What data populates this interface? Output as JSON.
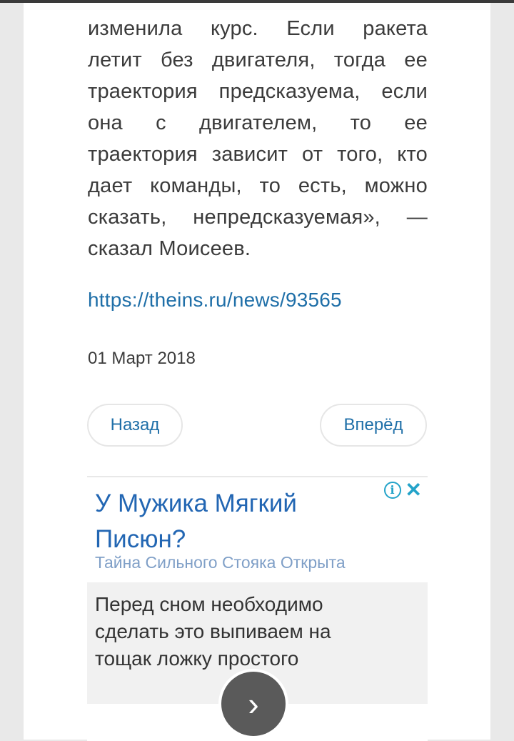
{
  "article": {
    "lines": [
      [
        "изменила",
        "курс.",
        "Если",
        "ракета"
      ],
      [
        "летит",
        "без",
        "двигателя,",
        "тогда",
        "ее"
      ],
      [
        "траектория",
        "предсказуема,",
        "если"
      ],
      [
        "она",
        "с",
        "двигателем,",
        "то",
        "ее"
      ],
      [
        "траектория",
        "зависит",
        "от",
        "того,",
        "кто"
      ],
      [
        "дает",
        "команды,",
        "то",
        "есть,",
        "можно"
      ],
      [
        "сказать,",
        "непредсказуемая»,",
        "—"
      ],
      [
        "сказал",
        "Моисеев."
      ]
    ]
  },
  "source_link": "https://theins.ru/news/93565",
  "date": "01 Март 2018",
  "nav": {
    "back_label": "Назад",
    "forward_label": "Вперёд"
  },
  "ad": {
    "title": "У Мужика Мягкий Писюн?",
    "subtitle": "Тайна Сильного Стояка Открыта",
    "body": "Перед сном необходимо сделать это выпиваем на тощак ложку простого",
    "info_icon": "ⓘ",
    "close_icon": "✕",
    "next_icon": "›"
  },
  "colors": {
    "link": "#1f6fa8",
    "ad_title": "#2266b3",
    "ad_icon": "#23a3c9"
  }
}
